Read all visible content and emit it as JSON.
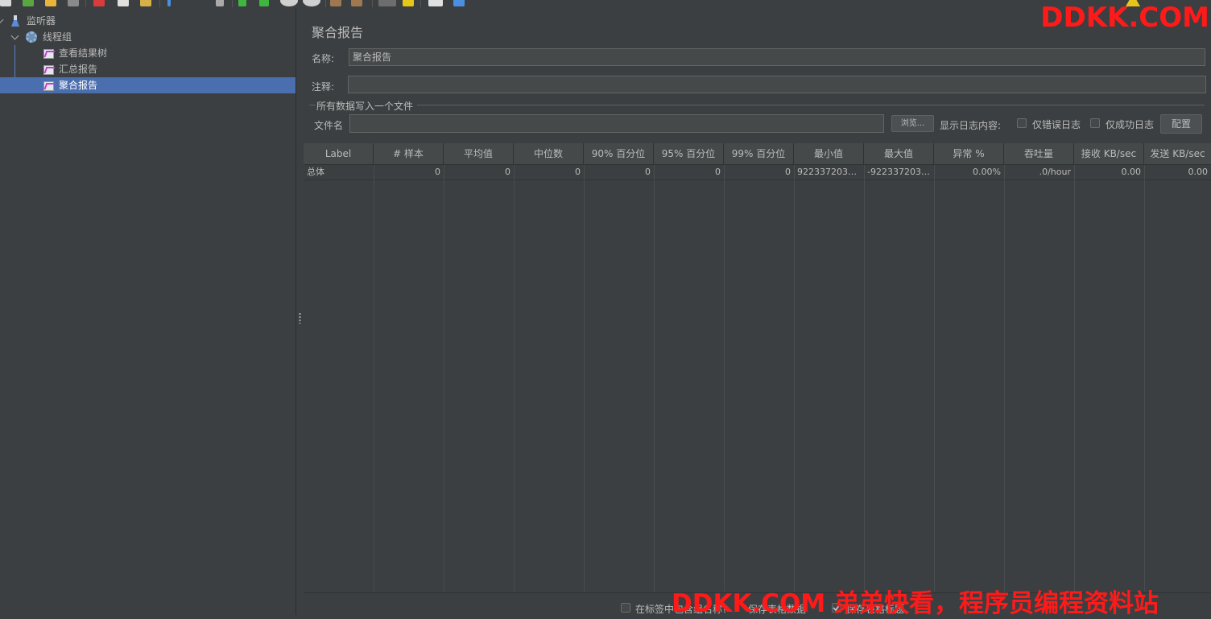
{
  "tree": {
    "items": [
      {
        "label": "监听器",
        "icon": "flask-icon"
      },
      {
        "label": "线程组",
        "icon": "gear-icon"
      },
      {
        "label": "查看结果树",
        "icon": "chart-icon"
      },
      {
        "label": "汇总报告",
        "icon": "chart-icon"
      },
      {
        "label": "聚合报告",
        "icon": "chart-icon",
        "selected": true
      }
    ]
  },
  "panel": {
    "title": "聚合报告",
    "name_label": "名称:",
    "name_value": "聚合报告",
    "comment_label": "注释:",
    "comment_value": "",
    "file_group_title": "所有数据写入一个文件",
    "filename_label": "文件名",
    "filename_value": "",
    "browse_button": "浏览...",
    "log_content_label": "显示日志内容:",
    "errors_only_label": "仅错误日志",
    "success_only_label": "仅成功日志",
    "configure_button": "配置"
  },
  "table": {
    "headers": [
      "Label",
      "# 样本",
      "平均值",
      "中位数",
      "90% 百分位",
      "95% 百分位",
      "99% 百分位",
      "最小值",
      "最大值",
      "异常 %",
      "吞吐量",
      "接收 KB/sec",
      "发送 KB/sec"
    ],
    "rows": [
      [
        "总体",
        "0",
        "0",
        "0",
        "0",
        "0",
        "0",
        "92233720368...",
        "-9223372036...",
        "0.00%",
        ".0/hour",
        "0.00",
        "0.00"
      ]
    ]
  },
  "bottom": {
    "label1": "在标签中包含组名称?",
    "label2": "保存表格数据",
    "label3": "保存表格标题"
  },
  "watermark": {
    "top": "DDKK.COM",
    "bottom": "DDKK.COM 弟弟快看，程序员编程资料站"
  },
  "colors": {
    "background": "#3c3f41",
    "selection": "#4b6eaf",
    "watermark": "#ff1a1a"
  }
}
